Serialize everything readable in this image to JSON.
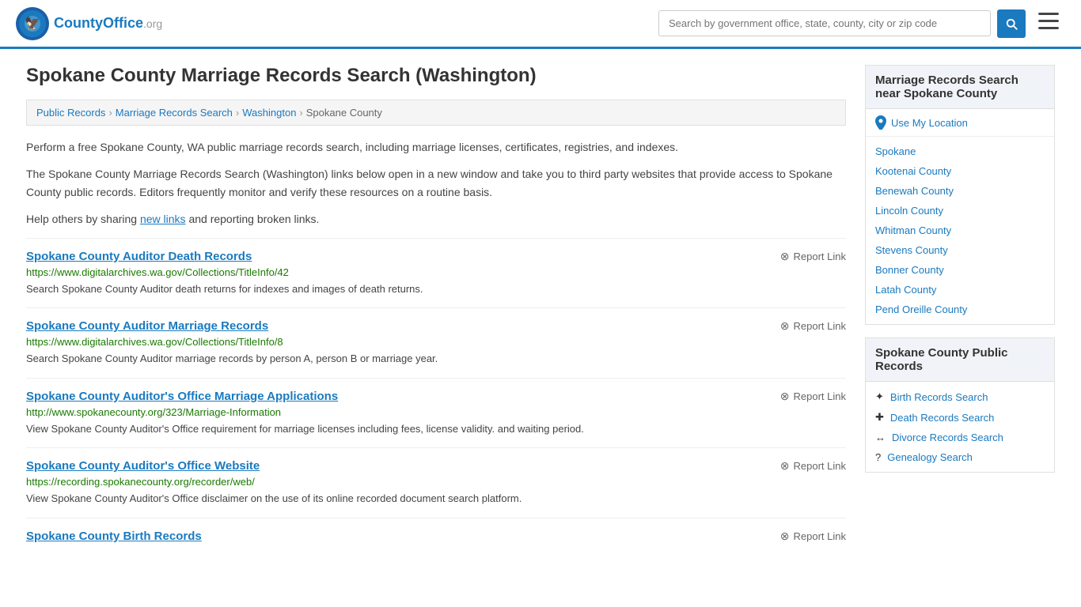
{
  "header": {
    "logo_text": "CountyOffice",
    "logo_suffix": ".org",
    "search_placeholder": "Search by government office, state, county, city or zip code",
    "search_value": ""
  },
  "page": {
    "title": "Spokane County Marriage Records Search (Washington)",
    "breadcrumb": [
      "Public Records",
      "Marriage Records Search",
      "Washington",
      "Spokane County"
    ],
    "desc1": "Perform a free Spokane County, WA public marriage records search, including marriage licenses, certificates, registries, and indexes.",
    "desc2": "The Spokane County Marriage Records Search (Washington) links below open in a new window and take you to third party websites that provide access to Spokane County public records. Editors frequently monitor and verify these resources on a routine basis.",
    "desc3_pre": "Help others by sharing ",
    "desc3_link": "new links",
    "desc3_post": " and reporting broken links."
  },
  "results": [
    {
      "title": "Spokane County Auditor Death Records",
      "url": "https://www.digitalarchives.wa.gov/Collections/TitleInfo/42",
      "desc": "Search Spokane County Auditor death returns for indexes and images of death returns.",
      "report_label": "Report Link"
    },
    {
      "title": "Spokane County Auditor Marriage Records",
      "url": "https://www.digitalarchives.wa.gov/Collections/TitleInfo/8",
      "desc": "Search Spokane County Auditor marriage records by person A, person B or marriage year.",
      "report_label": "Report Link"
    },
    {
      "title": "Spokane County Auditor's Office Marriage Applications",
      "url": "http://www.spokanecounty.org/323/Marriage-Information",
      "desc": "View Spokane County Auditor's Office requirement for marriage licenses including fees, license validity. and waiting period.",
      "report_label": "Report Link"
    },
    {
      "title": "Spokane County Auditor's Office Website",
      "url": "https://recording.spokanecounty.org/recorder/web/",
      "desc": "View Spokane County Auditor's Office disclaimer on the use of its online recorded document search platform.",
      "report_label": "Report Link"
    },
    {
      "title": "Spokane County Birth Records",
      "url": "",
      "desc": "",
      "report_label": "Report Link"
    }
  ],
  "sidebar": {
    "nearby_title": "Marriage Records Search near Spokane County",
    "use_location_label": "Use My Location",
    "nearby_links": [
      {
        "label": "Spokane",
        "icon": ""
      },
      {
        "label": "Kootenai County",
        "icon": ""
      },
      {
        "label": "Benewah County",
        "icon": ""
      },
      {
        "label": "Lincoln County",
        "icon": ""
      },
      {
        "label": "Whitman County",
        "icon": ""
      },
      {
        "label": "Stevens County",
        "icon": ""
      },
      {
        "label": "Bonner County",
        "icon": ""
      },
      {
        "label": "Latah County",
        "icon": ""
      },
      {
        "label": "Pend Oreille County",
        "icon": ""
      }
    ],
    "public_records_title": "Spokane County Public Records",
    "public_records_links": [
      {
        "label": "Birth Records Search",
        "icon": "✦"
      },
      {
        "label": "Death Records Search",
        "icon": "✚"
      },
      {
        "label": "Divorce Records Search",
        "icon": "↔"
      },
      {
        "label": "Genealogy Search",
        "icon": "?"
      }
    ]
  }
}
